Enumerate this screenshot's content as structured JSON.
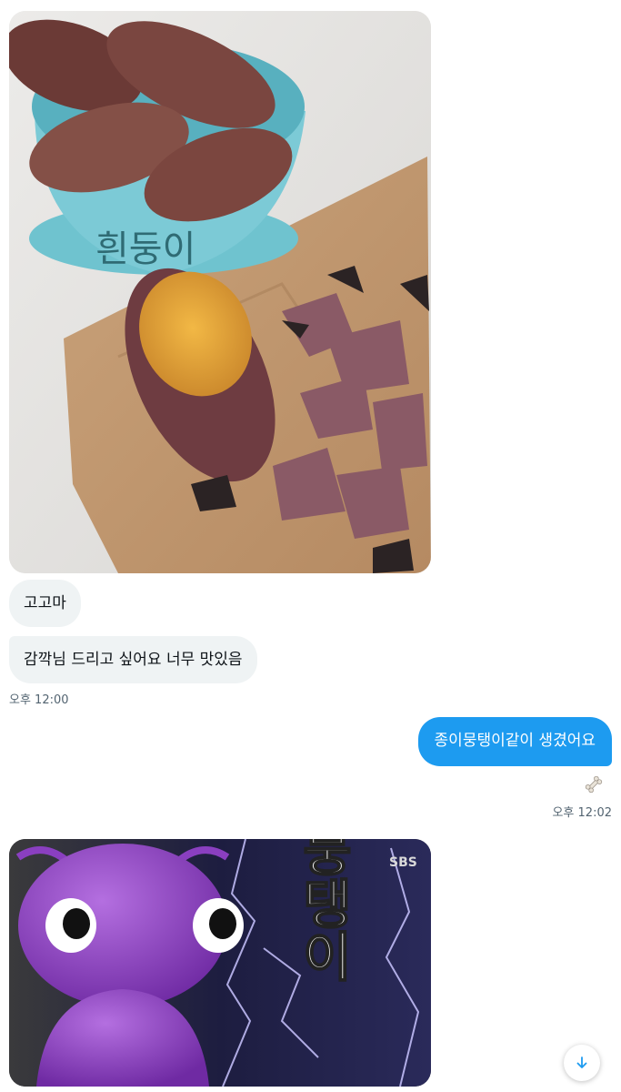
{
  "conversation": {
    "messages": [
      {
        "direction": "in",
        "kind": "image",
        "image_text": "흰둥이"
      },
      {
        "direction": "in",
        "kind": "text",
        "text": "고고마"
      },
      {
        "direction": "in",
        "kind": "text",
        "text": "감깍님 드리고 싶어요 너무 맛있음"
      },
      {
        "direction": "meta",
        "kind": "timestamp",
        "text": "오후 12:00"
      },
      {
        "direction": "out",
        "kind": "text",
        "text": "종이뭉탱이같이 생겼어요"
      },
      {
        "direction": "meta",
        "kind": "reaction",
        "icon": "bone-icon"
      },
      {
        "direction": "meta",
        "kind": "timestamp",
        "text": "오후 12:02"
      },
      {
        "direction": "in",
        "kind": "image",
        "image_text": "뭉탱이",
        "badge": "SBS"
      }
    ]
  },
  "colors": {
    "incoming_bubble": "#eff3f4",
    "outgoing_bubble": "#1d9bf0",
    "timestamp": "#536471"
  },
  "controls": {
    "scroll_down_icon": "arrow-down-icon"
  }
}
